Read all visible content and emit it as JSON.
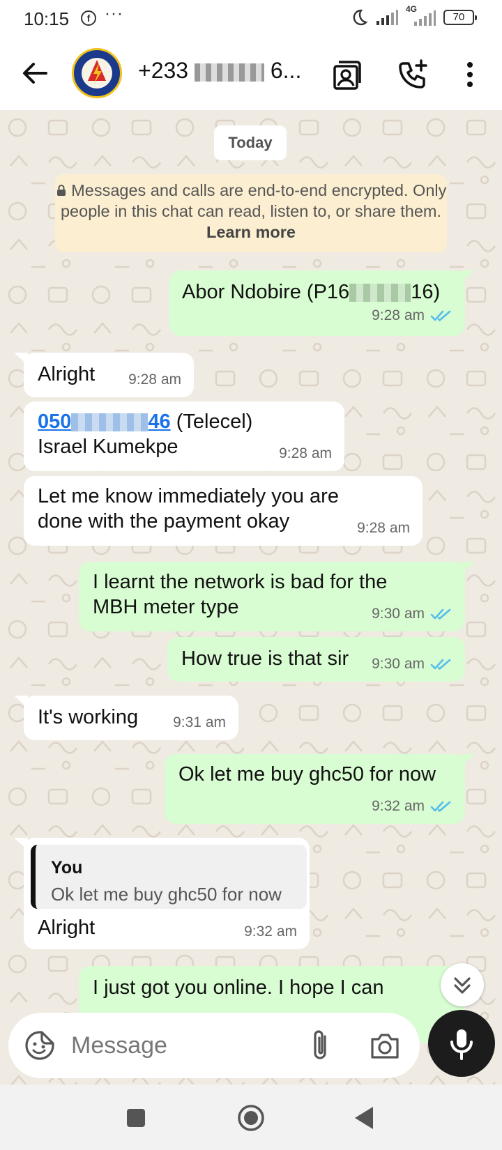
{
  "status_bar": {
    "time": "10:15",
    "dots": "···",
    "network": "4G",
    "battery": "70"
  },
  "header": {
    "title": "+233",
    "title_suffix": "6..."
  },
  "chat": {
    "day_label": "Today",
    "encryption_notice": "Messages and calls are end-to-end encrypted. Only people in this chat can read, listen to, or share them.",
    "learn_more": "Learn more",
    "messages": [
      {
        "dir": "out",
        "text_prefix": "Abor Ndobire (P16",
        "text_suffix": "16)",
        "time": "9:28 am"
      },
      {
        "dir": "in",
        "text": "Alright",
        "time": "9:28 am"
      },
      {
        "dir": "in",
        "link_prefix": "050",
        "link_suffix": "46",
        "after_link": " (Telecel)",
        "line2": "Israel Kumekpe",
        "time": "9:28 am"
      },
      {
        "dir": "in",
        "line1": "Let me know immediately you are",
        "line2": "done with the payment okay",
        "time": "9:28 am"
      },
      {
        "dir": "out",
        "line1": "I learnt the network is bad for the",
        "line2": "MBH meter type",
        "time": "9:30 am"
      },
      {
        "dir": "out",
        "text": "How true is that sir",
        "time": "9:30 am"
      },
      {
        "dir": "in",
        "text": "It's working",
        "time": "9:31 am"
      },
      {
        "dir": "out",
        "text": "Ok let me buy ghc50 for now",
        "time": "9:32 am"
      },
      {
        "dir": "in",
        "quote_name": "You",
        "quote_text": "Ok let me buy ghc50 for now",
        "text": "Alright",
        "time": "9:32 am"
      },
      {
        "dir": "out",
        "text": "I just got you online. I hope I can"
      }
    ]
  },
  "composer": {
    "placeholder": "Message"
  },
  "colors": {
    "outgoing_bubble": "#d9fdd3",
    "incoming_bubble": "#ffffff",
    "wallpaper": "#efeae2",
    "read_ticks": "#53bdeb",
    "link": "#1a73e8"
  },
  "icons": [
    "back-arrow-icon",
    "contact-avatar",
    "contact-card-icon",
    "add-call-icon",
    "more-vert-icon",
    "lock-icon",
    "double-check-icon",
    "scroll-down-icon",
    "sticker-icon",
    "attach-icon",
    "camera-icon",
    "mic-icon",
    "nav-recents-icon",
    "nav-home-icon",
    "nav-back-icon"
  ]
}
